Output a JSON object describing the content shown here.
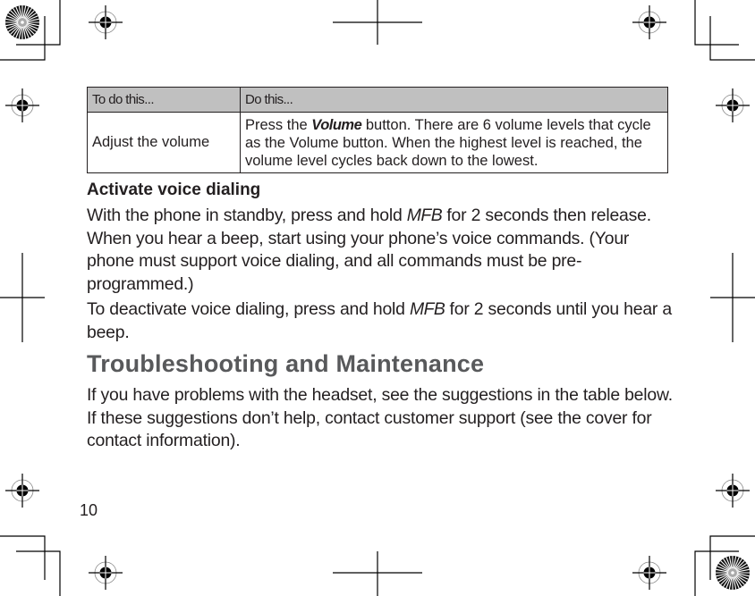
{
  "table": {
    "headers": [
      "To do this...",
      "Do this..."
    ],
    "rows": [
      {
        "action": "Adjust the volume",
        "instruction_pre": "Press the ",
        "instruction_em": "Volume",
        "instruction_post": " button. There are 6 volume levels that cycle as the Volume button. When the highest level is reached, the volume level cycles back down to the lowest."
      }
    ]
  },
  "voice_dialing": {
    "heading": "Activate voice dialing",
    "para1_pre": "With the phone in standby, press and hold ",
    "para1_em": "MFB",
    "para1_post": " for 2 seconds then release. When you hear a beep, start using your phone’s voice commands. (Your phone must support voice dialing, and all commands must be pre-programmed.)",
    "para2_pre": "To deactivate voice dialing, press and hold ",
    "para2_em": "MFB",
    "para2_post": " for 2 seconds until you hear a beep."
  },
  "troubleshooting": {
    "heading": "Troubleshooting and Maintenance",
    "text": "If you have problems with the headset, see the suggestions in the table below. If these suggestions don’t help, contact customer support (see the cover for contact information)."
  },
  "page_number": "10",
  "colors": {
    "heading_gray": "#58595b",
    "table_header_bg": "#c0c0c0",
    "text": "#231f20"
  }
}
